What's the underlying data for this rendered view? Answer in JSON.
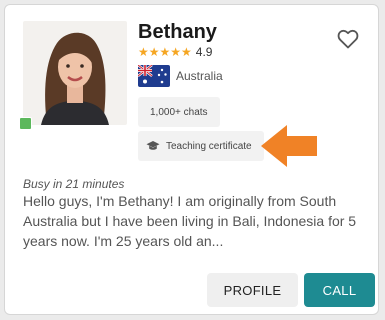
{
  "tutor": {
    "name": "Bethany",
    "stars": "★★★★★",
    "rating": "4.9",
    "country": "Australia",
    "chats": "1,000+ chats",
    "certificate": "Teaching certificate",
    "busy": "Busy in 21 minutes",
    "bio": "Hello guys, I'm Bethany! I am originally from South Australia but I have been living in Bali, Indonesia for 5 years now. I'm 25 years old an..."
  },
  "buttons": {
    "profile": "PROFILE",
    "call": "CALL"
  },
  "icons": {
    "favorite": "heart-outline-icon",
    "certificate": "graduation-cap-icon",
    "annotation": "arrow-left-icon",
    "flag": "australia-flag-icon"
  },
  "colors": {
    "call_button": "#1e8b92",
    "stars": "#f5a623",
    "online_status": "#5cb85c",
    "arrow": "#f08226"
  }
}
